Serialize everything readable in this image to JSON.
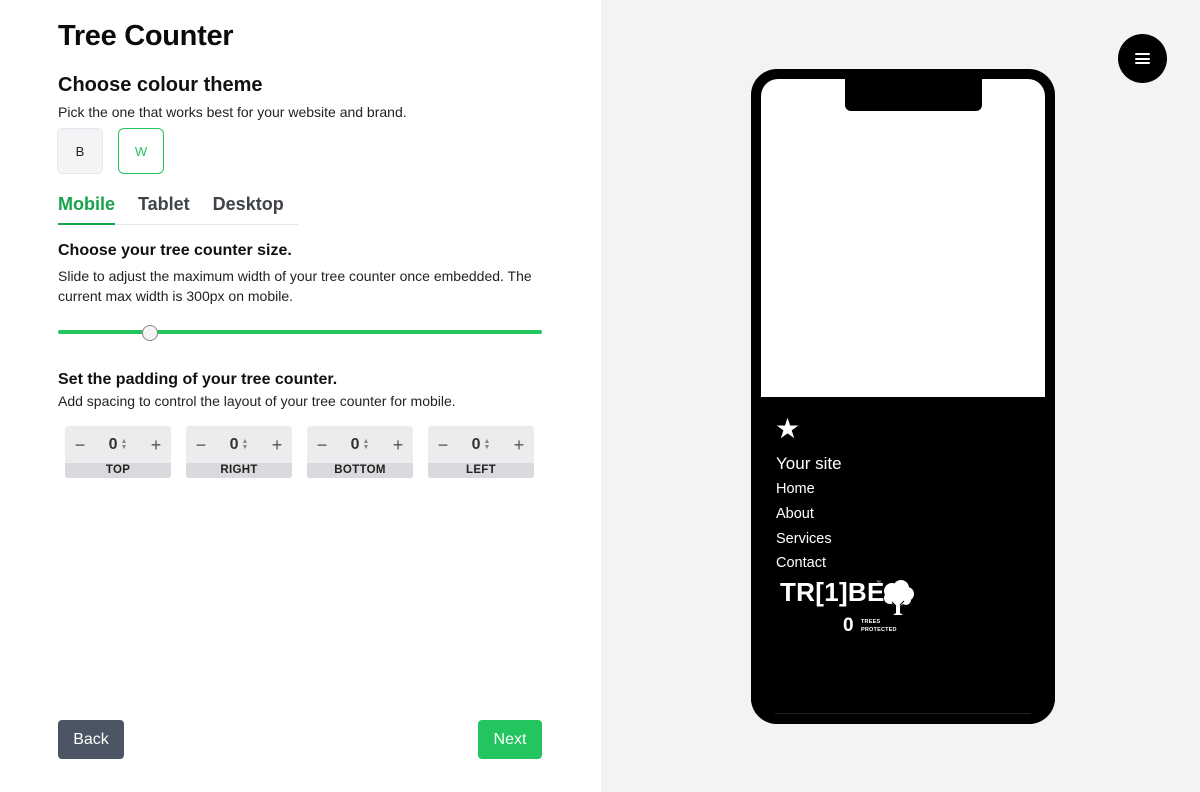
{
  "page": {
    "title": "Tree Counter"
  },
  "theme": {
    "title": "Choose colour theme",
    "description": "Pick the one that works best for your website and brand.",
    "options": [
      {
        "label": "B",
        "selected": false
      },
      {
        "label": "W",
        "selected": true
      }
    ],
    "accent_color": "#22c55e"
  },
  "tabs": [
    {
      "label": "Mobile",
      "active": true
    },
    {
      "label": "Tablet",
      "active": false
    },
    {
      "label": "Desktop",
      "active": false
    }
  ],
  "size": {
    "title": "Choose your tree counter size.",
    "description": "Slide to adjust the maximum width of your tree counter once embedded. The current max width is 300px on mobile.",
    "slider_fraction": 0.19
  },
  "padding": {
    "title": "Set the padding of your tree counter.",
    "description": "Add spacing to control the layout of your tree counter for mobile.",
    "fields": [
      {
        "label": "TOP",
        "value": "0",
        "minus": "−",
        "plus": "+"
      },
      {
        "label": "RIGHT",
        "value": "0",
        "minus": "−",
        "plus": "+"
      },
      {
        "label": "BOTTOM",
        "value": "0",
        "minus": "−",
        "plus": "+"
      },
      {
        "label": "LEFT",
        "value": "0",
        "minus": "−",
        "plus": "+"
      }
    ]
  },
  "actions": {
    "back_label": "Back",
    "next_label": "Next"
  },
  "preview": {
    "menu_icon": "hamburger-menu-icon",
    "logo_icon": "★",
    "site_name": "Your site",
    "nav": [
      "Home",
      "About",
      "Services",
      "Contact"
    ],
    "widget": {
      "brand": "TR[1]BE",
      "trademark": "™",
      "count": "0",
      "count_label_line1": "TREES",
      "count_label_line2": "PROTECTED"
    }
  }
}
